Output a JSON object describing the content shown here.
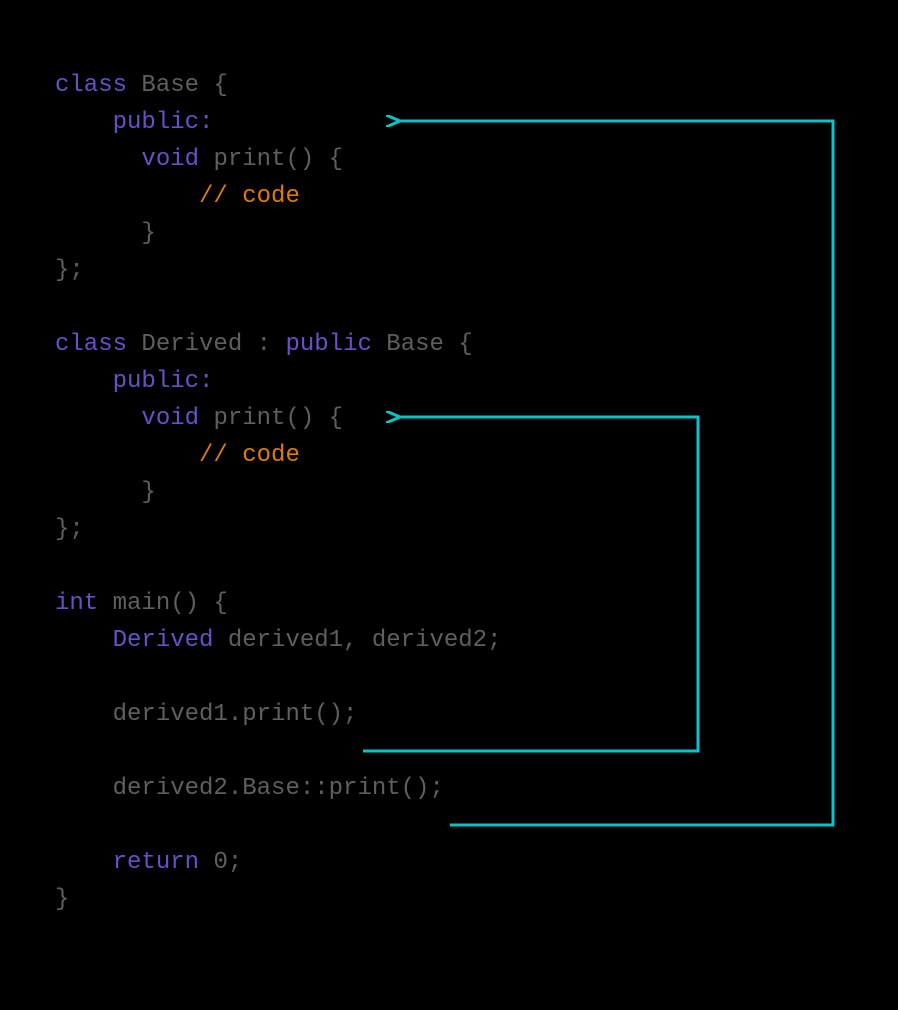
{
  "tokens": {
    "class_kw": "class",
    "base_name": "Base",
    "lbrace": "{",
    "rbrace": "}",
    "rbrace_semi": "};",
    "public_kw": "public:",
    "void_kw": "void",
    "print_sig": "print() {",
    "comment": "// code",
    "derived_name": "Derived",
    "colon": ":",
    "public_inherit": "public",
    "int_kw": "int",
    "main_sig": "main() {",
    "derived_type": "Derived",
    "vars": "derived1, derived2;",
    "call1": "derived1.print();",
    "call2": "derived2.Base::print();",
    "return_kw": "return",
    "zero": "0;"
  },
  "colors": {
    "keyword": "#6a4fc9",
    "identifier": "#5f5f5f",
    "comment": "#e07b00",
    "arrow": "#06c6c9",
    "background": "#000000"
  },
  "arrows": [
    {
      "from": "derived1.print()",
      "to": "Derived::print()"
    },
    {
      "from": "derived2.Base::print()",
      "to": "Base::print()"
    }
  ]
}
